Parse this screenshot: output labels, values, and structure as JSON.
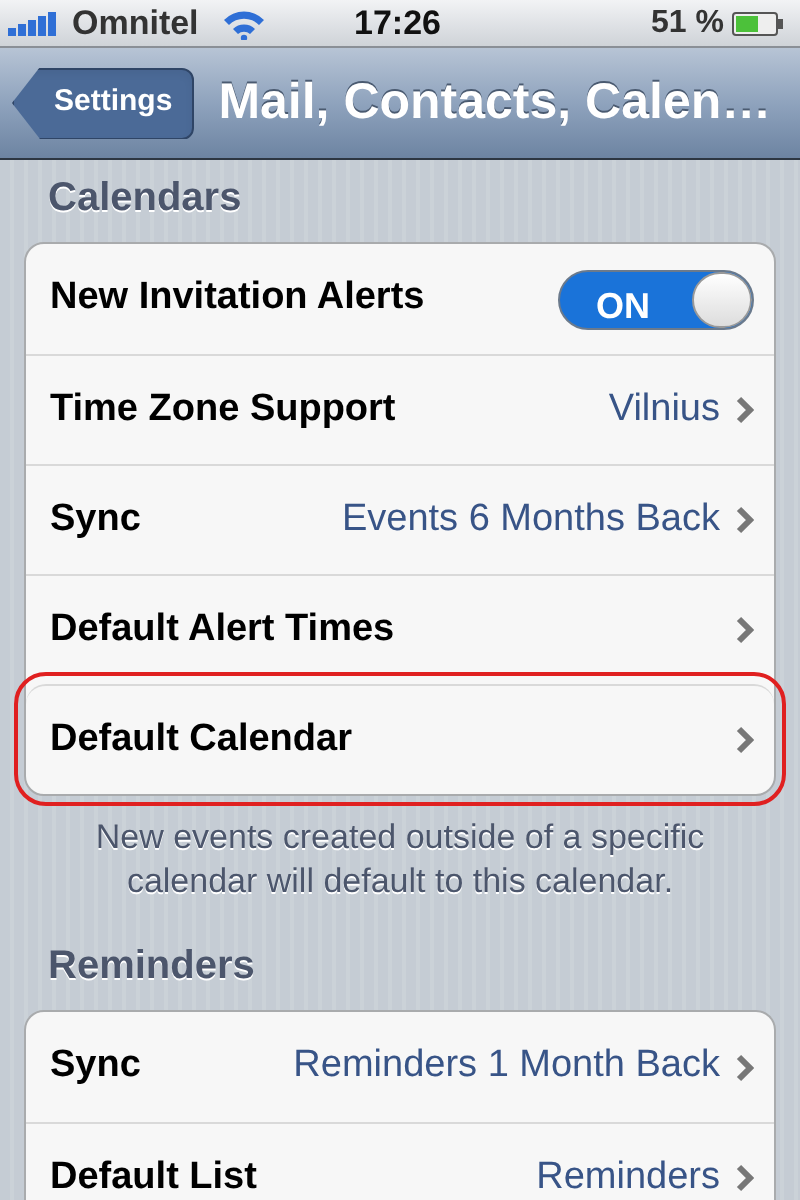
{
  "status_bar": {
    "carrier": "Omnitel",
    "time": "17:26",
    "battery": "51 %"
  },
  "nav_bar": {
    "back": "Settings",
    "title": "Mail, Contacts, Calen…"
  },
  "sections": [
    {
      "header": "Calendars",
      "footer": "New events created outside of a specific calendar will default to this calendar.",
      "rows": [
        {
          "kind": "toggle",
          "label": "New Invitation Alerts",
          "on": true,
          "switch_label": "ON",
          "highlighted": false
        },
        {
          "kind": "link",
          "label": "Time Zone Support",
          "value": "Vilnius",
          "highlighted": false
        },
        {
          "kind": "link",
          "label": "Sync",
          "value": "Events 6 Months Back",
          "highlighted": false
        },
        {
          "kind": "link",
          "label": "Default Alert Times",
          "highlighted": false
        },
        {
          "kind": "link",
          "label": "Default Calendar",
          "highlighted": true
        }
      ]
    },
    {
      "header": "Reminders",
      "rows": [
        {
          "kind": "link",
          "label": "Sync",
          "value": "Reminders 1 Month Back",
          "highlighted": false
        },
        {
          "kind": "link",
          "label": "Default List",
          "value": "Reminders",
          "highlighted": false
        }
      ]
    }
  ]
}
